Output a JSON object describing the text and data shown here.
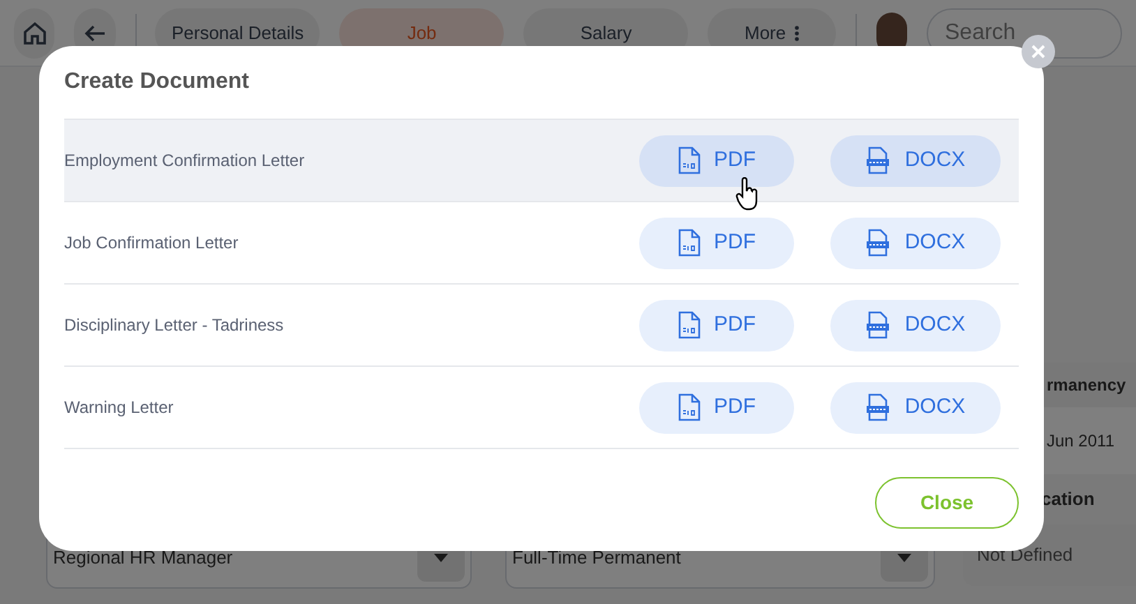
{
  "nav": {
    "tabs": [
      {
        "label": "Personal Details",
        "selected": false
      },
      {
        "label": "Job",
        "selected": true
      },
      {
        "label": "Salary",
        "selected": false
      },
      {
        "label": "More",
        "selected": false,
        "kind": "menu"
      }
    ],
    "search": {
      "placeholder": "Search"
    }
  },
  "background": {
    "fields": [
      "Regional HR Manager",
      "Full-Time Permanent"
    ],
    "side_table": [
      "rmanency",
      "Jun 2011",
      "cation",
      "Not Defined"
    ]
  },
  "dialog": {
    "title": "Create Document",
    "rows": [
      {
        "name": "Employment Confirmation Letter",
        "highlighted": true,
        "buttons": [
          "PDF",
          "DOCX"
        ]
      },
      {
        "name": "Job Confirmation Letter",
        "highlighted": false,
        "buttons": [
          "PDF",
          "DOCX"
        ]
      },
      {
        "name": "Disciplinary Letter - Tadriness",
        "highlighted": false,
        "buttons": [
          "PDF",
          "DOCX"
        ]
      },
      {
        "name": "Warning Letter",
        "highlighted": false,
        "buttons": [
          "PDF",
          "DOCX"
        ]
      }
    ],
    "close_button": "Close"
  }
}
